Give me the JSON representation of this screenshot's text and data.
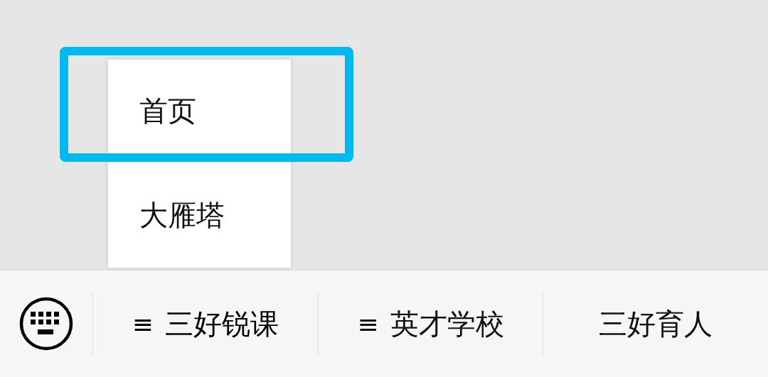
{
  "submenu": {
    "items": [
      {
        "label": "首页",
        "highlighted": true
      },
      {
        "label": "大雁塔",
        "highlighted": false
      }
    ]
  },
  "menu_bar": {
    "items": [
      {
        "label": "三好锐课",
        "mark": "≡",
        "expanded": true
      },
      {
        "label": "英才学校",
        "mark": "≡",
        "expanded": false
      },
      {
        "label": "三好育人",
        "expanded": false
      }
    ]
  }
}
